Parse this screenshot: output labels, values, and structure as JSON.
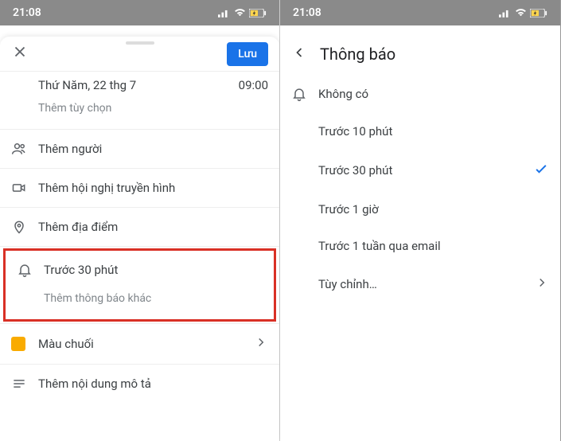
{
  "status": {
    "time": "21:08"
  },
  "left": {
    "save_label": "Lưu",
    "date_label": "Thứ Năm, 22 thg 7",
    "time_label": "09:00",
    "add_option": "Thêm tùy chọn",
    "add_people": "Thêm người",
    "add_video": "Thêm hội nghị truyền hình",
    "add_location": "Thêm địa điểm",
    "notification_value": "Trước 30 phút",
    "add_notification": "Thêm thông báo khác",
    "color_label": "Màu chuối",
    "add_description": "Thêm nội dung mô tả"
  },
  "right": {
    "title": "Thông báo",
    "options": {
      "none": "Không có",
      "10min": "Trước 10 phút",
      "30min": "Trước 30 phút",
      "1hour": "Trước 1 giờ",
      "1week_email": "Trước 1 tuần qua email",
      "custom": "Tùy chỉnh…"
    }
  }
}
